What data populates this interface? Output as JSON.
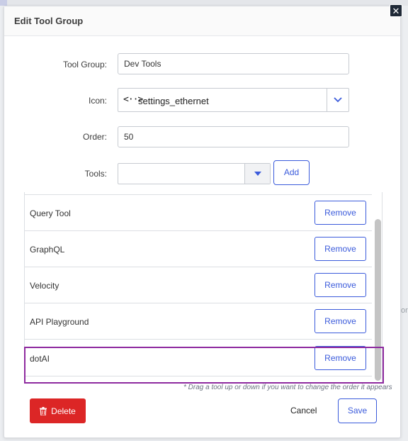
{
  "dialog": {
    "title": "Edit Tool Group",
    "close_label": "✕"
  },
  "form": {
    "tool_group_label": "Tool Group:",
    "tool_group_value": "Dev Tools",
    "icon_label": "Icon:",
    "icon_glyph": "<··>",
    "icon_value": "settings_ethernet",
    "order_label": "Order:",
    "order_value": "50",
    "tools_label": "Tools:",
    "tools_value": "",
    "add_label": "Add"
  },
  "tool_list": {
    "items": [
      {
        "name": "Query Tool",
        "remove_label": "Remove"
      },
      {
        "name": "GraphQL",
        "remove_label": "Remove"
      },
      {
        "name": "Velocity",
        "remove_label": "Remove"
      },
      {
        "name": "API Playground",
        "remove_label": "Remove"
      },
      {
        "name": "dotAI",
        "remove_label": "Remove"
      }
    ],
    "hint": "* Drag a tool up or down if you want to change the order it appears"
  },
  "footer": {
    "delete_label": "Delete",
    "cancel_label": "Cancel",
    "save_label": "Save"
  },
  "background": {
    "right_text": "or"
  },
  "colors": {
    "accent": "#3b5bdb",
    "danger": "#dc2626",
    "highlight": "#8e2a9f"
  }
}
